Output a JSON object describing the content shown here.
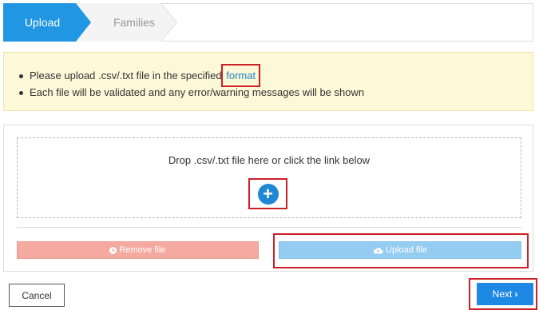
{
  "steps": [
    {
      "label": "Upload",
      "active": true
    },
    {
      "label": "Families",
      "active": false
    }
  ],
  "info": {
    "line1_prefix": "Please upload .csv/.txt file in the specified ",
    "line1_link": "format",
    "line2": "Each file will be validated and any error/warning messages will be shown"
  },
  "dropzone": {
    "text": "Drop .csv/.txt file here or click the link below",
    "add_icon": "plus-circle-icon"
  },
  "buttons": {
    "remove_label": "Remove file",
    "upload_label": "Upload file",
    "cancel_label": "Cancel",
    "next_label": "Next"
  },
  "icons": {
    "remove": "times-circle-icon",
    "upload": "cloud-upload-icon",
    "next": "chevron-right-icon"
  },
  "colors": {
    "primary": "#2196e3",
    "info_bg": "#fcf8d8",
    "highlight": "#cc1f26",
    "remove_bg": "#f4aaa0",
    "upload_bg": "#94ccf2"
  }
}
